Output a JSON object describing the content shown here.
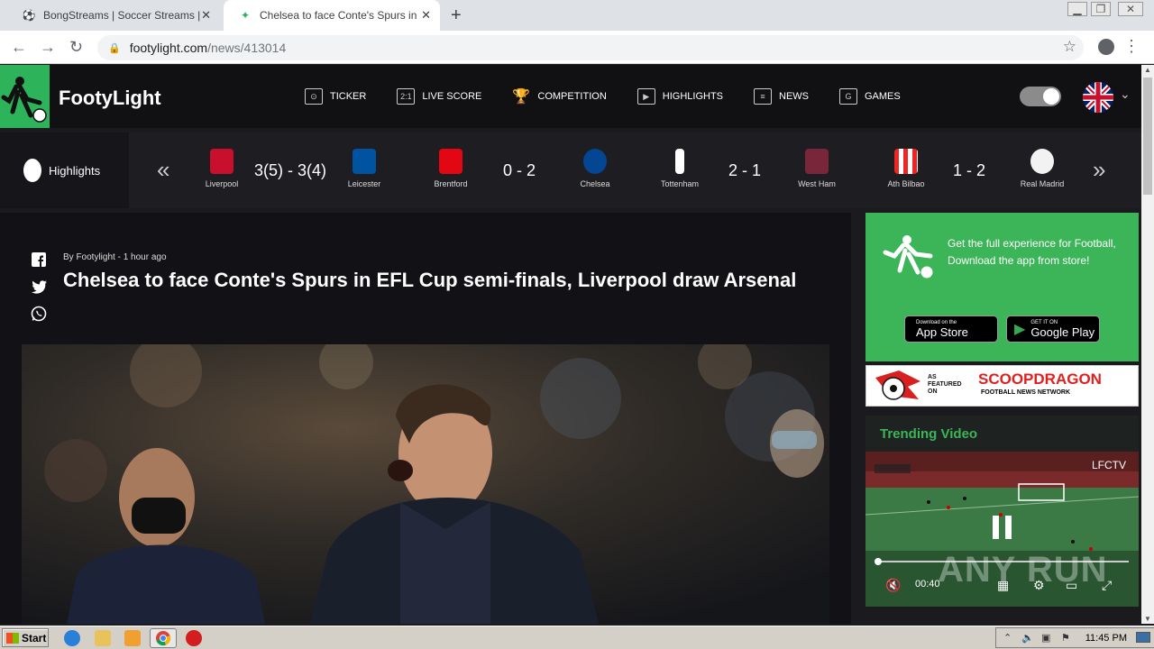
{
  "browser": {
    "tabs": [
      {
        "title": "BongStreams | Soccer Streams | NBA",
        "active": false
      },
      {
        "title": "Chelsea to face Conte's Spurs in EFL",
        "active": true
      }
    ],
    "url_domain": "footylight.com",
    "url_path": "/news/413014"
  },
  "site": {
    "name": "FootyLight",
    "menu": [
      {
        "label": "TICKER",
        "icon": "ticker-icon"
      },
      {
        "label": "LIVE SCORE",
        "icon": "live-score-icon",
        "glyph": "2:1"
      },
      {
        "label": "COMPETITION",
        "icon": "trophy-icon"
      },
      {
        "label": "HIGHLIGHTS",
        "icon": "play-icon"
      },
      {
        "label": "NEWS",
        "icon": "news-icon"
      },
      {
        "label": "GAMES",
        "icon": "games-icon"
      }
    ],
    "accent": "#2db35a"
  },
  "highlights": {
    "label": "Highlights",
    "matches": [
      {
        "home": "Liverpool",
        "away": "Leicester",
        "score": "3(5)  -  3(4)",
        "home_color": "#c8102e",
        "away_color": "#0053a0"
      },
      {
        "home": "Brentford",
        "away": "Chelsea",
        "score": "0  -  2",
        "home_color": "#e30613",
        "away_color": "#034694"
      },
      {
        "home": "Tottenham",
        "away": "West Ham",
        "score": "2  -  1",
        "home_color": "#ffffff",
        "away_color": "#7a263a"
      },
      {
        "home": "Ath Bilbao",
        "away": "Real Madrid",
        "score": "1  -  2",
        "home_color": "#ee2523",
        "away_color": "#f2f2f2"
      }
    ]
  },
  "article": {
    "byline": "By Footylight - 1 hour ago",
    "headline": "Chelsea to face Conte's Spurs in EFL Cup semi-finals, Liverpool draw Arsenal"
  },
  "promo": {
    "text": "Get the full experience for Football, Download the app from store!",
    "appstore_small": "Download on the",
    "appstore_big": "App Store",
    "googleplay_small": "GET IT ON",
    "googleplay_big": "Google Play"
  },
  "scoop": {
    "as_featured": "AS FEATURED ON",
    "name": "SCOOPDRAGON",
    "sub": "FOOTBALL NEWS NETWORK"
  },
  "trending": {
    "title": "Trending Video",
    "channel": "LFCTV",
    "time": "00:40"
  },
  "watermark": "ANY RUN",
  "taskbar": {
    "start": "Start",
    "clock": "11:45 PM"
  }
}
